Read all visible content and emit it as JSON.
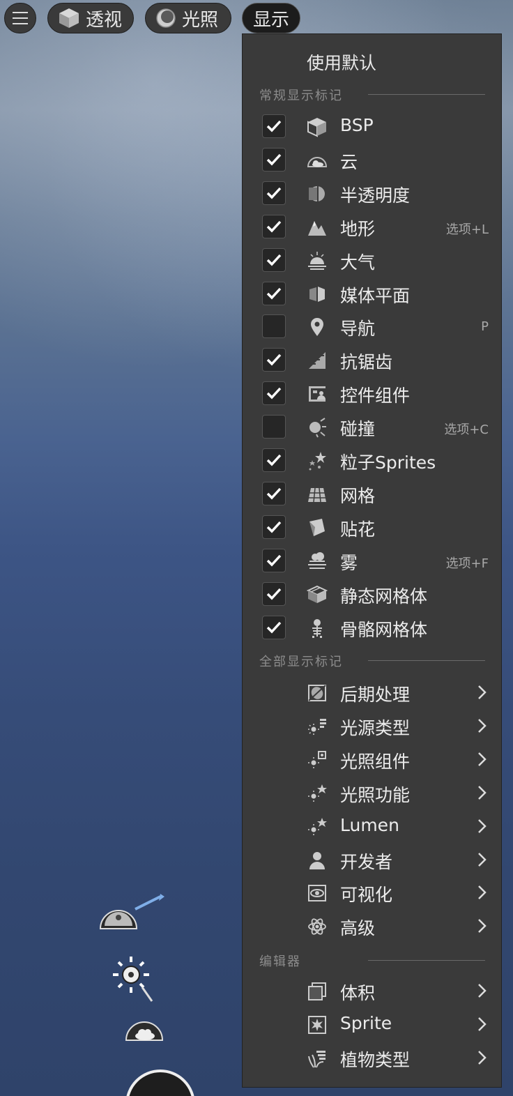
{
  "toolbar": {
    "perspective_label": "透视",
    "lighting_label": "光照",
    "show_label": "显示"
  },
  "menu": {
    "use_default": "使用默认",
    "sections": {
      "common": "常规显示标记",
      "all": "全部显示标记",
      "editor": "编辑器"
    },
    "common_flags": [
      {
        "label": "BSP",
        "checked": true,
        "icon": "bsp-cube-icon",
        "shortcut": ""
      },
      {
        "label": "云",
        "checked": true,
        "icon": "cloud-icon",
        "shortcut": ""
      },
      {
        "label": "半透明度",
        "checked": true,
        "icon": "translucency-icon",
        "shortcut": ""
      },
      {
        "label": "地形",
        "checked": true,
        "icon": "landscape-icon",
        "shortcut": "选项+L"
      },
      {
        "label": "大气",
        "checked": true,
        "icon": "atmosphere-icon",
        "shortcut": ""
      },
      {
        "label": "媒体平面",
        "checked": true,
        "icon": "media-plane-icon",
        "shortcut": ""
      },
      {
        "label": "导航",
        "checked": false,
        "icon": "navigation-pin-icon",
        "shortcut": "P"
      },
      {
        "label": "抗锯齿",
        "checked": true,
        "icon": "anti-aliasing-icon",
        "shortcut": ""
      },
      {
        "label": "控件组件",
        "checked": true,
        "icon": "widget-component-icon",
        "shortcut": ""
      },
      {
        "label": "碰撞",
        "checked": false,
        "icon": "collision-icon",
        "shortcut": "选项+C"
      },
      {
        "label": "粒子Sprites",
        "checked": true,
        "icon": "particle-sprites-icon",
        "shortcut": ""
      },
      {
        "label": "网格",
        "checked": true,
        "icon": "grid-icon",
        "shortcut": ""
      },
      {
        "label": "贴花",
        "checked": true,
        "icon": "decal-icon",
        "shortcut": ""
      },
      {
        "label": "雾",
        "checked": true,
        "icon": "fog-icon",
        "shortcut": "选项+F"
      },
      {
        "label": "静态网格体",
        "checked": true,
        "icon": "static-mesh-icon",
        "shortcut": ""
      },
      {
        "label": "骨骼网格体",
        "checked": true,
        "icon": "skeletal-mesh-icon",
        "shortcut": ""
      }
    ],
    "all_flags": [
      {
        "label": "后期处理",
        "icon": "post-process-icon"
      },
      {
        "label": "光源类型",
        "icon": "light-types-icon"
      },
      {
        "label": "光照组件",
        "icon": "lighting-components-icon"
      },
      {
        "label": "光照功能",
        "icon": "lighting-features-icon"
      },
      {
        "label": "Lumen",
        "icon": "lumen-icon"
      },
      {
        "label": "开发者",
        "icon": "developer-icon"
      },
      {
        "label": "可视化",
        "icon": "visualize-icon"
      },
      {
        "label": "高级",
        "icon": "advanced-atom-icon"
      }
    ],
    "editor_flags": [
      {
        "label": "体积",
        "icon": "volume-icon"
      },
      {
        "label": "Sprite",
        "icon": "sprite-icon"
      },
      {
        "label": "植物类型",
        "icon": "foliage-types-icon"
      }
    ]
  }
}
